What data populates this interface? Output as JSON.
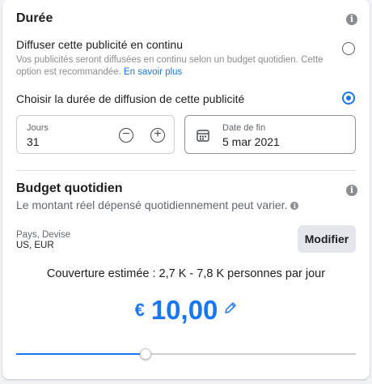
{
  "duration": {
    "title": "Durée",
    "option_continuous": {
      "label": "Diffuser cette publicité en continu",
      "description": "Vos publicités seront diffusées en continu selon un budget quotidien. Cette option est recommandée.",
      "link": "En savoir plus",
      "selected": false
    },
    "option_fixed": {
      "label": "Choisir la durée de diffusion de cette publicité",
      "selected": true
    },
    "days": {
      "label": "Jours",
      "value": "31"
    },
    "end_date": {
      "label": "Date de fin",
      "value": "5 mar 2021"
    }
  },
  "budget": {
    "title": "Budget quotidien",
    "subtitle": "Le montant réel dépensé quotidiennement peut varier.",
    "country_currency": {
      "label": "Pays, Devise",
      "value": "US, EUR"
    },
    "modify_button": "Modifier",
    "coverage": "Couverture estimée : 2,7 K - 7,8 K personnes par jour",
    "currency_symbol": "€",
    "amount": "10,00",
    "slider_fraction": 0.38
  },
  "colors": {
    "accent": "#1877f2",
    "track": "#ccd0d5"
  }
}
